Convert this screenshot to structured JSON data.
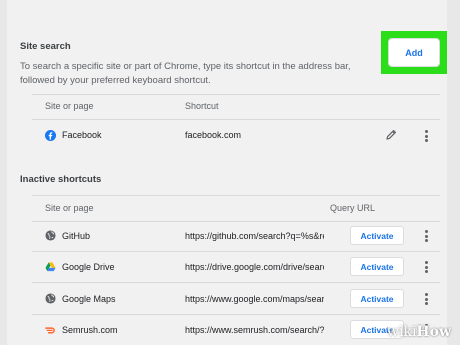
{
  "site_search": {
    "title": "Site search",
    "description": "To search a specific site or part of Chrome, type its shortcut in the address bar, followed by your preferred keyboard shortcut.",
    "add_label": "Add",
    "columns": {
      "site": "Site or page",
      "shortcut": "Shortcut"
    },
    "entries": [
      {
        "name": "Facebook",
        "shortcut": "facebook.com",
        "icon": "facebook-icon"
      }
    ]
  },
  "inactive": {
    "title": "Inactive shortcuts",
    "columns": {
      "site": "Site or page",
      "query": "Query URL"
    },
    "activate_label": "Activate",
    "entries": [
      {
        "name": "GitHub",
        "url": "https://github.com/search?q=%s&ref",
        "icon": "globe-icon"
      },
      {
        "name": "Google Drive",
        "url": "https://drive.google.com/drive/searc",
        "icon": "google-drive-icon"
      },
      {
        "name": "Google Maps",
        "url": "https://www.google.com/maps/searc",
        "icon": "globe-icon"
      },
      {
        "name": "Semrush.com",
        "url": "https://www.semrush.com/search/?c",
        "icon": "semrush-icon"
      }
    ]
  },
  "watermark": {
    "wiki": "wiki",
    "how": "How"
  },
  "colors": {
    "accent": "#1a73e8",
    "highlight": "#2cde1a",
    "facebook": "#1877f2",
    "semrush": "#ff642d"
  }
}
